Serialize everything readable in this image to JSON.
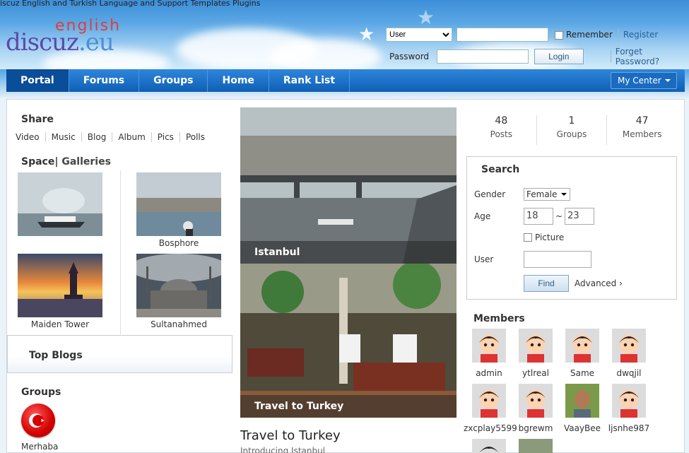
{
  "site": {
    "tagline": "iscuz English and Turkish Language and Support Templates Plugins",
    "logo_top": "english",
    "logo_main": "discuz",
    "logo_ext": ".eu"
  },
  "login": {
    "user_select": "User",
    "remember": "Remember",
    "register": "Register",
    "password_label": "Password",
    "login_button": "Login",
    "forget": "Forget Password?"
  },
  "nav": {
    "items": [
      "Portal",
      "Forums",
      "Groups",
      "Home",
      "Rank List"
    ],
    "my_center": "My Center"
  },
  "share": {
    "title": "Share",
    "links": [
      "Video",
      "Music",
      "Blog",
      "Album",
      "Pics",
      "Polls"
    ]
  },
  "space": {
    "title_a": "Space",
    "title_b": "Galleries",
    "captions": [
      "Bosphore",
      "Maiden Tower",
      "Sultanahmed"
    ]
  },
  "topblogs": {
    "title": "Top Blogs"
  },
  "groups": {
    "title": "Groups",
    "item": "Merhaba"
  },
  "feature": {
    "caption1": "Istanbul",
    "caption2": "Travel to Turkey",
    "title": "Travel to Turkey",
    "subtitle": "Introducing Istanbul"
  },
  "stats": [
    {
      "value": "48",
      "label": "Posts"
    },
    {
      "value": "1",
      "label": "Groups"
    },
    {
      "value": "47",
      "label": "Members"
    }
  ],
  "search": {
    "title": "Search",
    "gender_label": "Gender",
    "gender_value": "Female",
    "age_label": "Age",
    "age_from": "18",
    "age_sep": "~",
    "age_to": "23",
    "picture_label": "Picture",
    "user_label": "User",
    "find_button": "Find",
    "advanced": "Advanced ›"
  },
  "members": {
    "title": "Members",
    "names": [
      "admin",
      "ytlreal",
      "Same",
      "dwqjil",
      "zxcplay5599",
      "bgrewm",
      "VaayBee",
      "ljsnhe987"
    ]
  },
  "colors": {
    "nav_blue": "#0f5fb4",
    "accent_red": "#e23c3c"
  }
}
